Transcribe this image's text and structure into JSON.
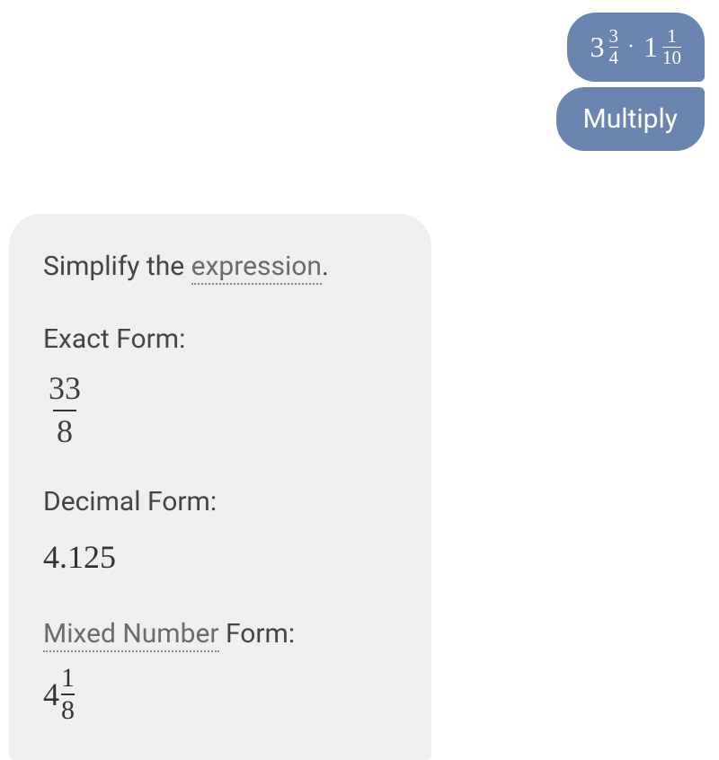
{
  "user_input": {
    "expression_bubble": {
      "term1_whole": "3",
      "term1_num": "3",
      "term1_den": "4",
      "operator": "·",
      "term2_whole": "1",
      "term2_num": "1",
      "term2_den": "10"
    },
    "command_bubble": "Multiply"
  },
  "answer": {
    "intro_prefix": "Simplify the ",
    "intro_link": "expression",
    "intro_suffix": ".",
    "exact_form_label": "Exact Form:",
    "exact_form_num": "33",
    "exact_form_den": "8",
    "decimal_form_label": "Decimal Form:",
    "decimal_form_value": "4.125",
    "mixed_form_link": "Mixed Number",
    "mixed_form_suffix": " Form:",
    "mixed_form_whole": "4",
    "mixed_form_num": "1",
    "mixed_form_den": "8"
  }
}
